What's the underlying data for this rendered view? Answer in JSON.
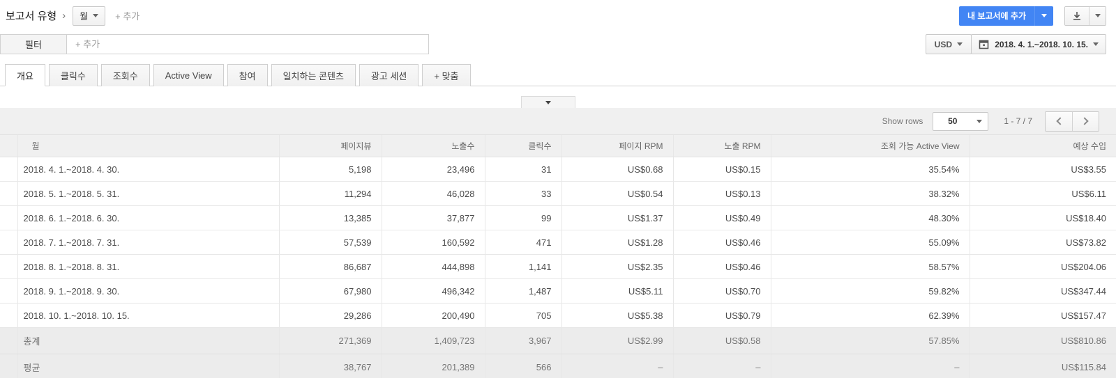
{
  "topbar": {
    "title": "보고서 유형",
    "breadcrumb_chevron": "›",
    "report_type": "월",
    "add_label": "+ 추가",
    "add_to_reports_label": "내 보고서에 추가"
  },
  "filter_bar": {
    "label": "필터",
    "placeholder": "+ 추가",
    "currency": "USD",
    "date_range": "2018. 4. 1.~2018. 10. 15."
  },
  "tabs": {
    "active_index": 0,
    "items": [
      "개요",
      "클릭수",
      "조회수",
      "Active View",
      "참여",
      "일치하는 콘텐츠",
      "광고 세션",
      "+ 맞춤"
    ]
  },
  "table_controls": {
    "show_rows_label": "Show rows",
    "show_rows_value": "50",
    "page_range": "1 - 7 / 7"
  },
  "table": {
    "columns": [
      "월",
      "페이지뷰",
      "노출수",
      "클릭수",
      "페이지 RPM",
      "노출 RPM",
      "조회 가능 Active View",
      "예상 수입"
    ],
    "rows": [
      {
        "label": "2018. 4. 1.~2018. 4. 30.",
        "values": [
          "5,198",
          "23,496",
          "31",
          "US$0.68",
          "US$0.15",
          "35.54%",
          "US$3.55"
        ]
      },
      {
        "label": "2018. 5. 1.~2018. 5. 31.",
        "values": [
          "11,294",
          "46,028",
          "33",
          "US$0.54",
          "US$0.13",
          "38.32%",
          "US$6.11"
        ]
      },
      {
        "label": "2018. 6. 1.~2018. 6. 30.",
        "values": [
          "13,385",
          "37,877",
          "99",
          "US$1.37",
          "US$0.49",
          "48.30%",
          "US$18.40"
        ]
      },
      {
        "label": "2018. 7. 1.~2018. 7. 31.",
        "values": [
          "57,539",
          "160,592",
          "471",
          "US$1.28",
          "US$0.46",
          "55.09%",
          "US$73.82"
        ]
      },
      {
        "label": "2018. 8. 1.~2018. 8. 31.",
        "values": [
          "86,687",
          "444,898",
          "1,141",
          "US$2.35",
          "US$0.46",
          "58.57%",
          "US$204.06"
        ]
      },
      {
        "label": "2018. 9. 1.~2018. 9. 30.",
        "values": [
          "67,980",
          "496,342",
          "1,487",
          "US$5.11",
          "US$0.70",
          "59.82%",
          "US$347.44"
        ]
      },
      {
        "label": "2018. 10. 1.~2018. 10. 15.",
        "values": [
          "29,286",
          "200,490",
          "705",
          "US$5.38",
          "US$0.79",
          "62.39%",
          "US$157.47"
        ]
      }
    ],
    "summary_rows": [
      {
        "label": "총계",
        "values": [
          "271,369",
          "1,409,723",
          "3,967",
          "US$2.99",
          "US$0.58",
          "57.85%",
          "US$810.86"
        ]
      },
      {
        "label": "평균",
        "values": [
          "38,767",
          "201,389",
          "566",
          "–",
          "–",
          "–",
          "US$115.84"
        ]
      }
    ]
  },
  "colors": {
    "accent_blue": "#4285f4"
  }
}
